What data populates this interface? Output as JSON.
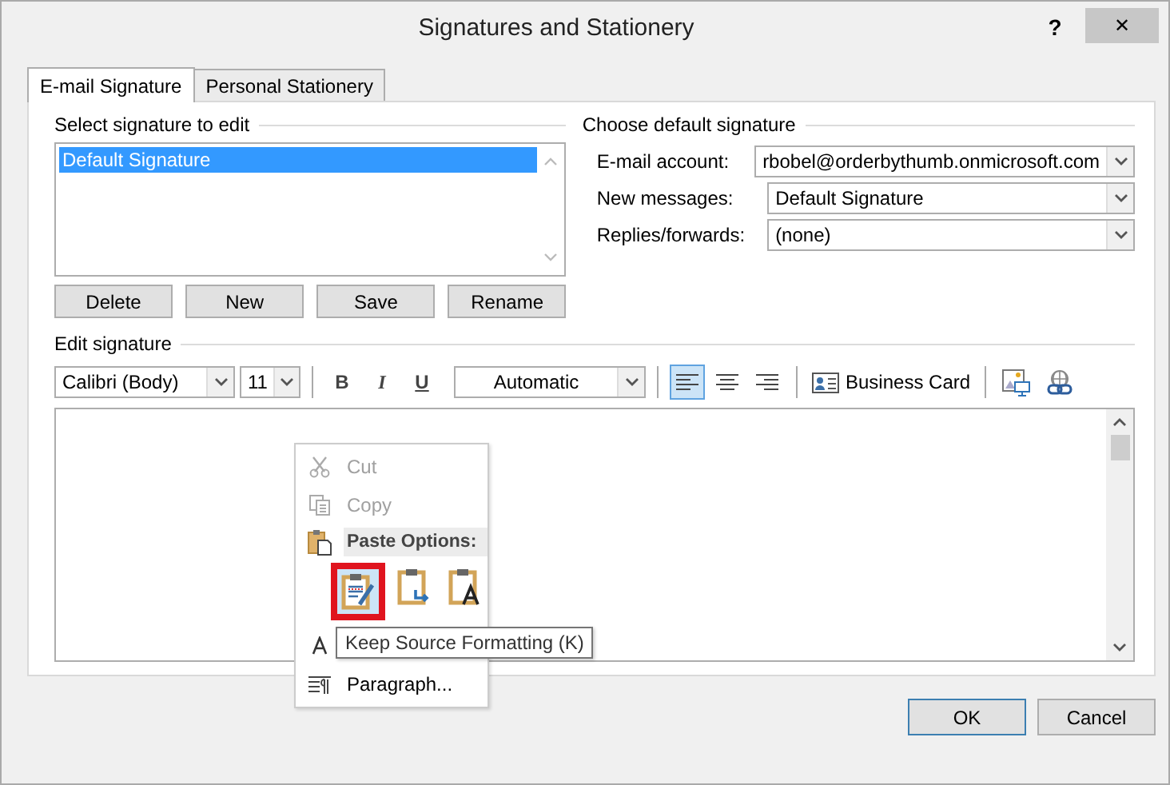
{
  "window": {
    "title": "Signatures and Stationery",
    "help": "?",
    "close": "✕"
  },
  "tabs": [
    {
      "label": "E-mail Signature",
      "selected": true
    },
    {
      "label": "Personal Stationery",
      "selected": false
    }
  ],
  "select_signature": {
    "heading": "Select signature to edit",
    "items": [
      {
        "label": "Default Signature",
        "selected": true
      }
    ],
    "buttons": [
      "Delete",
      "New",
      "Save",
      "Rename"
    ]
  },
  "default_signature": {
    "heading": "Choose default signature",
    "fields": [
      {
        "label": "E-mail account:",
        "value": "rbobel@orderbythumb.onmicrosoft.com"
      },
      {
        "label": "New messages:",
        "value": "Default Signature"
      },
      {
        "label": "Replies/forwards:",
        "value": "(none)"
      }
    ]
  },
  "edit_signature": {
    "heading": "Edit signature",
    "toolbar": {
      "font": "Calibri (Body)",
      "size": "11",
      "bold": "B",
      "italic": "I",
      "underline": "U",
      "font_color_choice": "Automatic",
      "alignments": [
        {
          "kind": "left",
          "selected": true
        },
        {
          "kind": "center",
          "selected": false
        },
        {
          "kind": "right",
          "selected": false
        }
      ],
      "business_card": "Business Card"
    }
  },
  "context_menu": {
    "items": [
      {
        "kind": "cut",
        "label": "Cut",
        "disabled": true
      },
      {
        "kind": "copy",
        "label": "Copy",
        "disabled": true
      },
      {
        "kind": "header",
        "label": "Paste Options:"
      },
      {
        "kind": "paste_options",
        "options": [
          {
            "kind": "keep_source",
            "selected": true
          },
          {
            "kind": "merge",
            "selected": false
          },
          {
            "kind": "text_only",
            "selected": false
          }
        ]
      },
      {
        "kind": "font",
        "disabled": false
      },
      {
        "kind": "paragraph",
        "label": "Paragraph...",
        "disabled": false
      }
    ]
  },
  "tooltip": "Keep Source Formatting (K)",
  "dialog_buttons": [
    "OK",
    "Cancel"
  ]
}
